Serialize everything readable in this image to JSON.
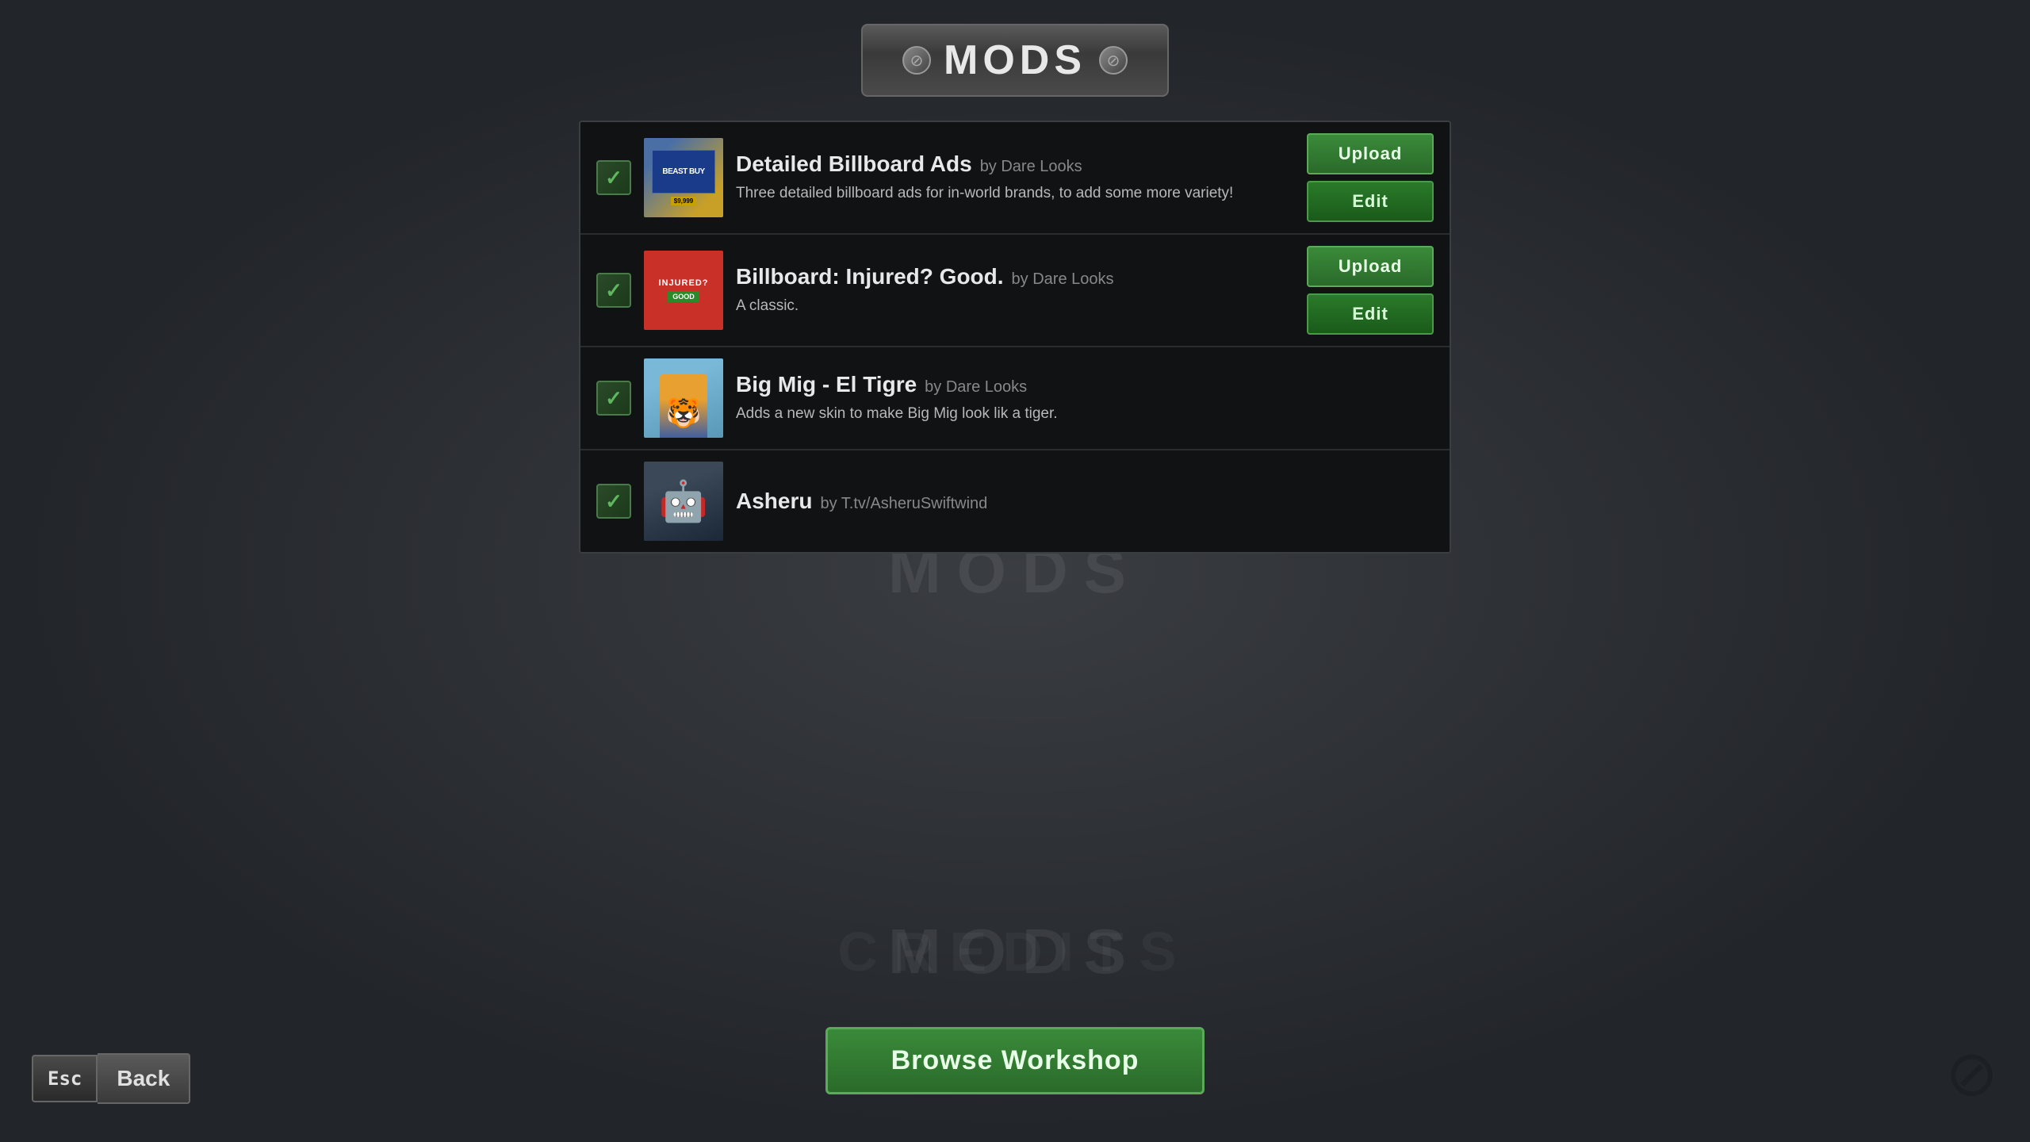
{
  "title": {
    "text": "MODS",
    "left_icon": "⊘",
    "right_icon": "⊘"
  },
  "mods": [
    {
      "id": "mod-1",
      "name": "Detailed Billboard Ads",
      "author": "by Dare Looks",
      "description": "Three detailed billboard ads for in-world brands, to add some more variety!",
      "enabled": true,
      "has_upload": true,
      "has_edit": true,
      "thumbnail_type": "billboard-ads"
    },
    {
      "id": "mod-2",
      "name": "Billboard: Injured? Good.",
      "author": "by Dare Looks",
      "description": "A classic.",
      "enabled": true,
      "has_upload": true,
      "has_edit": true,
      "thumbnail_type": "injured"
    },
    {
      "id": "mod-3",
      "name": "Big Mig - El Tigre",
      "author": "by Dare Looks",
      "description": "Adds a new skin to make Big Mig look lik a tiger.",
      "enabled": true,
      "has_upload": false,
      "has_edit": false,
      "thumbnail_type": "bigmig"
    },
    {
      "id": "mod-4",
      "name": "Asheru",
      "author": "by T.tv/AsheruSwiftwind",
      "description": "",
      "enabled": true,
      "has_upload": false,
      "has_edit": false,
      "thumbnail_type": "asheru"
    }
  ],
  "buttons": {
    "browse_workshop": "Browse Workshop",
    "upload": "Upload",
    "edit": "Edit",
    "back": "Back",
    "esc": "Esc"
  },
  "watermarks": {
    "credits": "CREDITS"
  }
}
